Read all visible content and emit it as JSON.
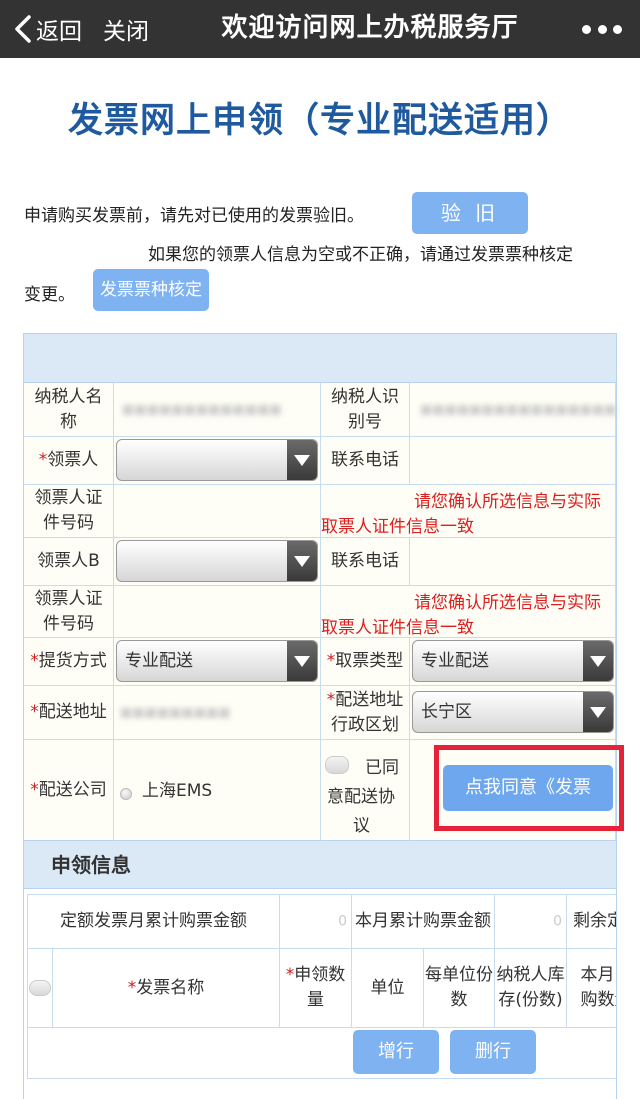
{
  "navbar": {
    "back_label": "返回",
    "close_label": "关闭",
    "title": "欢迎访问网上办税服务厅",
    "more_icon": "more-dots-icon"
  },
  "page": {
    "title": "发票网上申领（专业配送适用）",
    "note_verify": "申请购买发票前，请先对已使用的发票验旧。",
    "verify_button": "验 旧",
    "note_info_line1": "如果您的领票人信息为空或不正确，请通过发票票种核定",
    "note_info_line2": "变更。",
    "verify_type_button": "发票票种核定"
  },
  "form": {
    "taxpayer_name_label": "纳税人名称",
    "taxpayer_id_label": "纳税人识别号",
    "collector_label": "领票人",
    "phone_label": "联系电话",
    "collector_id_label": "领票人证件号码",
    "warning_line1": "请您确认所选信息与实际",
    "warning_line2": "取票人证件信息一致",
    "collector_b_label": "领票人B",
    "phone_b_label": "联系电话",
    "collector_b_id_label": "领票人证件号码",
    "warning_b_line1": "请您确认所选信息与实际",
    "warning_b_line2": "取票人证件信息一致",
    "delivery_method_label": "提货方式",
    "delivery_method_value": "专业配送",
    "pickup_type_label": "取票类型",
    "pickup_type_value": "专业配送",
    "delivery_address_label": "配送地址",
    "district_label": "配送地址行政区划",
    "district_value": "长宁区",
    "delivery_company_label": "配送公司",
    "delivery_company_value": "上海EMS",
    "agree_text_line1": "已同",
    "agree_text_line2": "意配送协",
    "agree_text_line3": "议",
    "agree_button": "点我同意《发票"
  },
  "apply": {
    "section_title": "申领信息",
    "fixed_amount_label": "定额发票月累计购票金额",
    "fixed_amount_value": "0",
    "month_amount_label": "本月累计购票金额",
    "month_amount_value": "0",
    "remaining_label": "剩余定额",
    "columns": [
      "发票名称",
      "申领数量",
      "单位",
      "每单位份数",
      "纳税人库存(份数)",
      "本月已购数量"
    ],
    "add_row_button": "增行",
    "delete_row_button": "删行"
  },
  "colors": {
    "navbar": "#333333",
    "title": "#1f5a9e",
    "button": "#7eb2f0",
    "header_band": "#dbe8f6",
    "warning": "#dd1e1e",
    "highlight_box": "#e6223a"
  }
}
